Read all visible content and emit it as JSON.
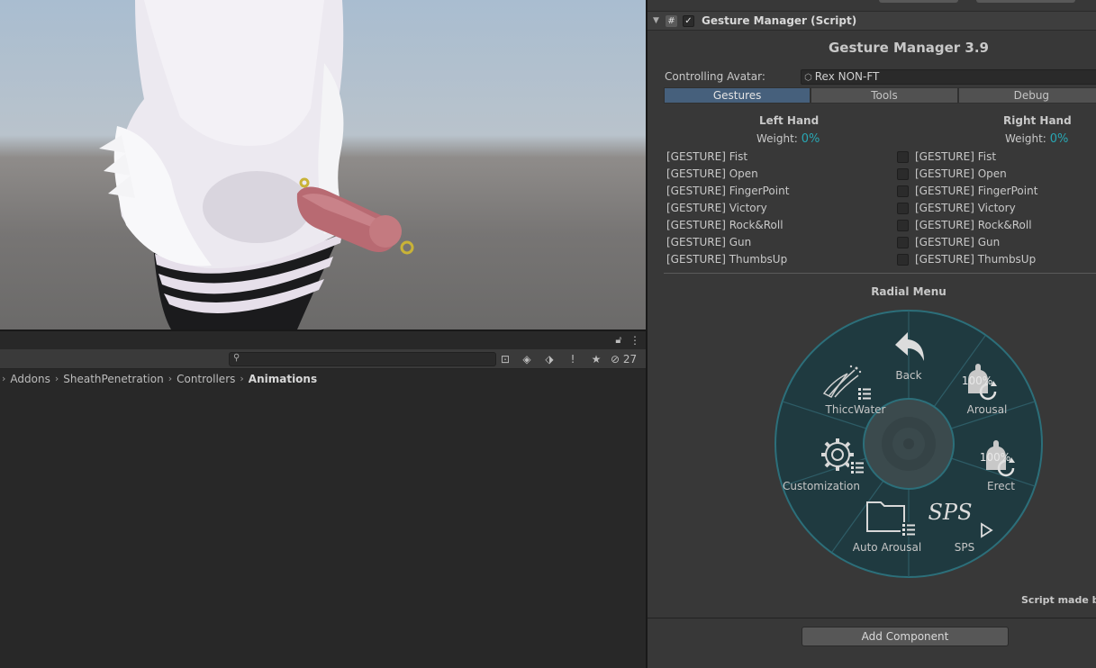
{
  "project": {
    "search": {
      "placeholder": "",
      "value": ""
    },
    "hidden_count": "27",
    "breadcrumb": [
      "Addons",
      "SheathPenetration",
      "Controllers",
      "Animations"
    ]
  },
  "inspector": {
    "component_title": "Gesture Manager (Script)",
    "gm_title": "Gesture Manager 3.9",
    "controlling_avatar_label": "Controlling Avatar:",
    "controlling_avatar_value": "Rex NON-FT",
    "tabs": [
      {
        "label": "Gestures",
        "active": true
      },
      {
        "label": "Tools",
        "active": false
      },
      {
        "label": "Debug",
        "active": false
      }
    ],
    "left_hand": {
      "title": "Left Hand",
      "weight_label": "Weight:",
      "weight_value": "0%"
    },
    "right_hand": {
      "title": "Right Hand",
      "weight_label": "Weight:",
      "weight_value": "0%"
    },
    "gestures": [
      "[GESTURE] Fist",
      "[GESTURE] Open",
      "[GESTURE] FingerPoint",
      "[GESTURE] Victory",
      "[GESTURE] Rock&Roll",
      "[GESTURE] Gun",
      "[GESTURE] ThumbsUp"
    ],
    "radial_title": "Radial Menu",
    "radial_items": {
      "back": "Back",
      "arousal": "Arousal",
      "arousal_pct": "100%",
      "erect": "Erect",
      "erect_pct": "100%",
      "sps": "SPS",
      "sps_logo": "SPS",
      "auto_arousal": "Auto Arousal",
      "customization": "Customization",
      "thiccwater": "ThiccWater"
    },
    "script_credit": "Script made by",
    "add_component": "Add Component"
  },
  "colors": {
    "accent_teal": "#28a7b4",
    "tab_active": "#46607c",
    "radial_fill": "#1f3a40",
    "radial_ring": "#2c6f7a"
  }
}
